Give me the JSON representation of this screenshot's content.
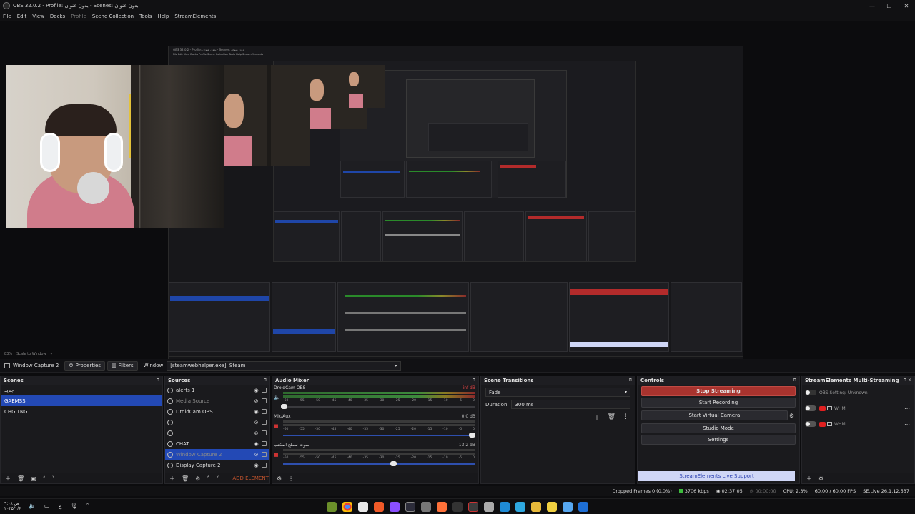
{
  "window": {
    "title": "OBS 32.0.2 - Profile: بدون عنوان - Scenes: بدون عنوان",
    "controls": [
      "—",
      "☐",
      "✕"
    ]
  },
  "menu": [
    "File",
    "Edit",
    "View",
    "Docks",
    "Profile",
    "Scene Collection",
    "Tools",
    "Help",
    "StreamElements"
  ],
  "preview": {
    "nested_title": "OBS 32.0.2 - Profile: بدون عنوان - Scenes: بدون عنوان",
    "nested_menu": "File  Edit  View  Docks  Profile  Scene Collection  Tools  Help  StreamElements"
  },
  "zoom": {
    "level": "83%",
    "mode": "Scale to Window"
  },
  "source_bar": {
    "source_name": "Window Capture 2",
    "properties_label": "Properties",
    "filters_label": "Filters",
    "window_label": "Window",
    "window_value": "[steamwebhelper.exe]: Steam"
  },
  "scenes": {
    "title": "Scenes",
    "items": [
      "جديد",
      "GAEMSS",
      "CHGITNG"
    ],
    "selected_index": 1
  },
  "sources": {
    "title": "Sources",
    "items": [
      {
        "label": "alerts 1",
        "dim": false
      },
      {
        "label": "Media Source",
        "dim": true
      },
      {
        "label": "DroidCam OBS",
        "dim": false
      },
      {
        "label": "",
        "dim": false
      },
      {
        "label": "",
        "dim": false
      },
      {
        "label": "CHAT",
        "dim": false
      },
      {
        "label": "Window Capture 2",
        "dim": true
      },
      {
        "label": "Display Capture 2",
        "dim": false
      }
    ],
    "selected_index": 6,
    "add_element": "ADD ELEMENT"
  },
  "audio_mixer": {
    "title": "Audio Mixer",
    "channels": [
      {
        "name": "DroidCam OBS",
        "db": "-inf dB",
        "level": 0.0,
        "volume": 0.0
      },
      {
        "name": "Mic/Aux",
        "db": "0.0 dB",
        "level": 0.0,
        "volume": 1.0
      },
      {
        "name": "صوت سطح المكتب",
        "db": "-13.2 dB",
        "level": 0.0,
        "volume": 0.59
      }
    ],
    "ticks": [
      "-60",
      "-55",
      "-50",
      "-45",
      "-40",
      "-35",
      "-30",
      "-25",
      "-20",
      "-15",
      "-10",
      "-5",
      "0"
    ]
  },
  "transitions": {
    "title": "Scene Transitions",
    "selected": "Fade",
    "duration_label": "Duration",
    "duration_value": "300 ms"
  },
  "controls": {
    "title": "Controls",
    "buttons": [
      "Stop Streaming",
      "Start Recording",
      "Start Virtual Camera",
      "Studio Mode",
      "Settings"
    ],
    "live_support": "StreamElements Live Support"
  },
  "multistream": {
    "title": "StreamElements Multi-Streaming",
    "status": "OBS Setting: Unknown",
    "rows": [
      "WHM",
      "WHM"
    ]
  },
  "status": {
    "dropped": "Dropped Frames 0 (0.0%)",
    "bitrate": "3706 kbps",
    "live_time": "02:37:05",
    "rec_time": "00:00:00",
    "cpu": "CPU: 2.3%",
    "fps": "60.00 / 60.00 FPS",
    "version": "SE.Live 26.1.12.537"
  },
  "taskbar": {
    "time": "۹:۰۸ ص",
    "date": "۲۰۲۵/۱/۶",
    "lang": "ع",
    "colors": {
      "accent": "#2349b5",
      "stop": "#a8332e",
      "add_element": "#c0532d"
    }
  }
}
